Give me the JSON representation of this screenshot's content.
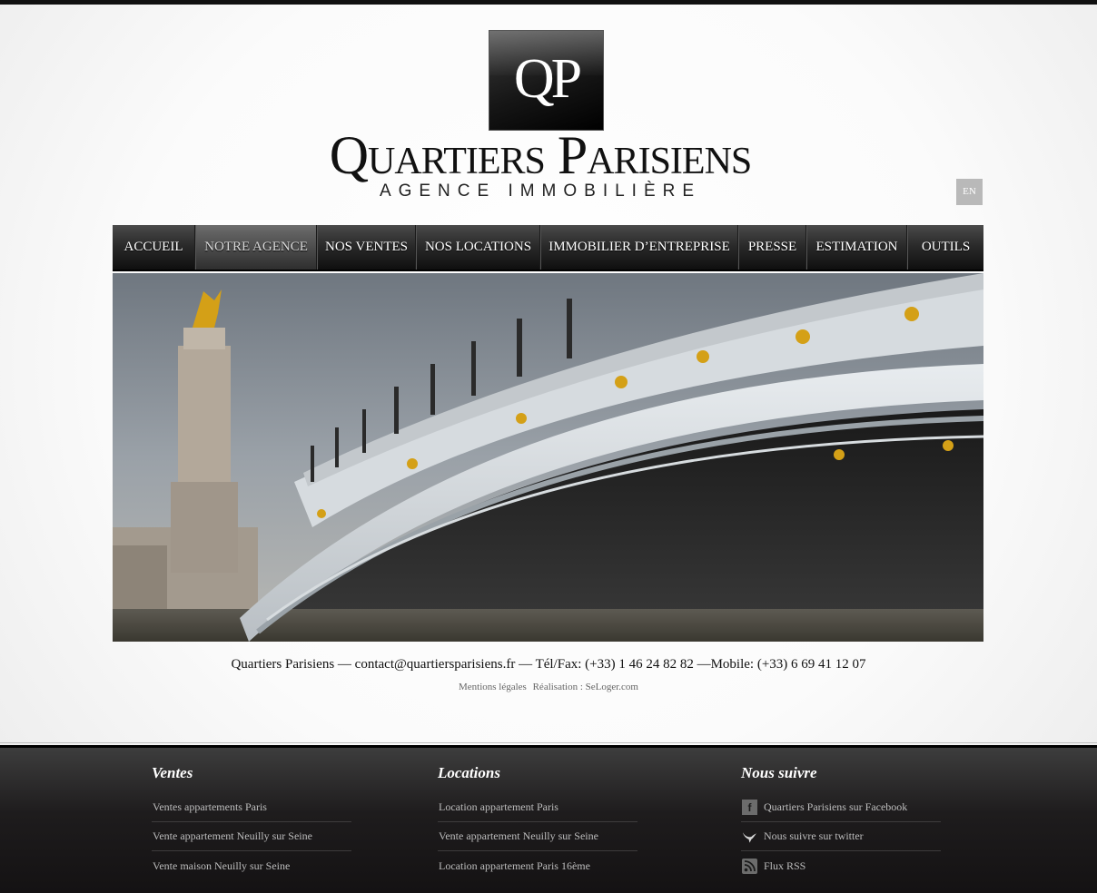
{
  "logo": {
    "monogram": "QP",
    "name": "Quartiers Parisiens",
    "tagline": "AGENCE IMMOBILIÈRE"
  },
  "lang_button": "EN",
  "nav": {
    "items": [
      {
        "label": "Accueil",
        "active": false
      },
      {
        "label": "Notre agence",
        "active": true
      },
      {
        "label": "Nos ventes",
        "active": false
      },
      {
        "label": "Nos locations",
        "active": false
      },
      {
        "label": "Immobilier d’entreprise",
        "active": false
      },
      {
        "label": "Presse",
        "active": false
      },
      {
        "label": "Estimation",
        "active": false
      },
      {
        "label": "Outils",
        "active": false
      }
    ]
  },
  "contact": {
    "line": "Quartiers Parisiens — contact@quartiersparisiens.fr — Tél/Fax: (+33) 1 46 24 82 82 —Mobile: (+33) 6 69 41 12 07"
  },
  "credits": {
    "mentions": "Mentions légales",
    "realisation": "Réalisation : SeLoger.com"
  },
  "footer": {
    "ventes": {
      "title": "Ventes",
      "links": [
        "Ventes appartements Paris",
        "Vente appartement Neuilly sur Seine",
        "Vente maison Neuilly sur Seine"
      ]
    },
    "locations": {
      "title": "Locations",
      "links": [
        "Location appartement Paris",
        "Vente appartement Neuilly sur Seine",
        "Location appartement Paris 16ème"
      ]
    },
    "suivre": {
      "title": "Nous suivre",
      "links": [
        {
          "label": "Quartiers Parisiens sur Facebook",
          "icon": "facebook-icon"
        },
        {
          "label": "Nous suivre sur twitter",
          "icon": "twitter-icon"
        },
        {
          "label": "Flux RSS",
          "icon": "rss-icon"
        }
      ]
    }
  }
}
